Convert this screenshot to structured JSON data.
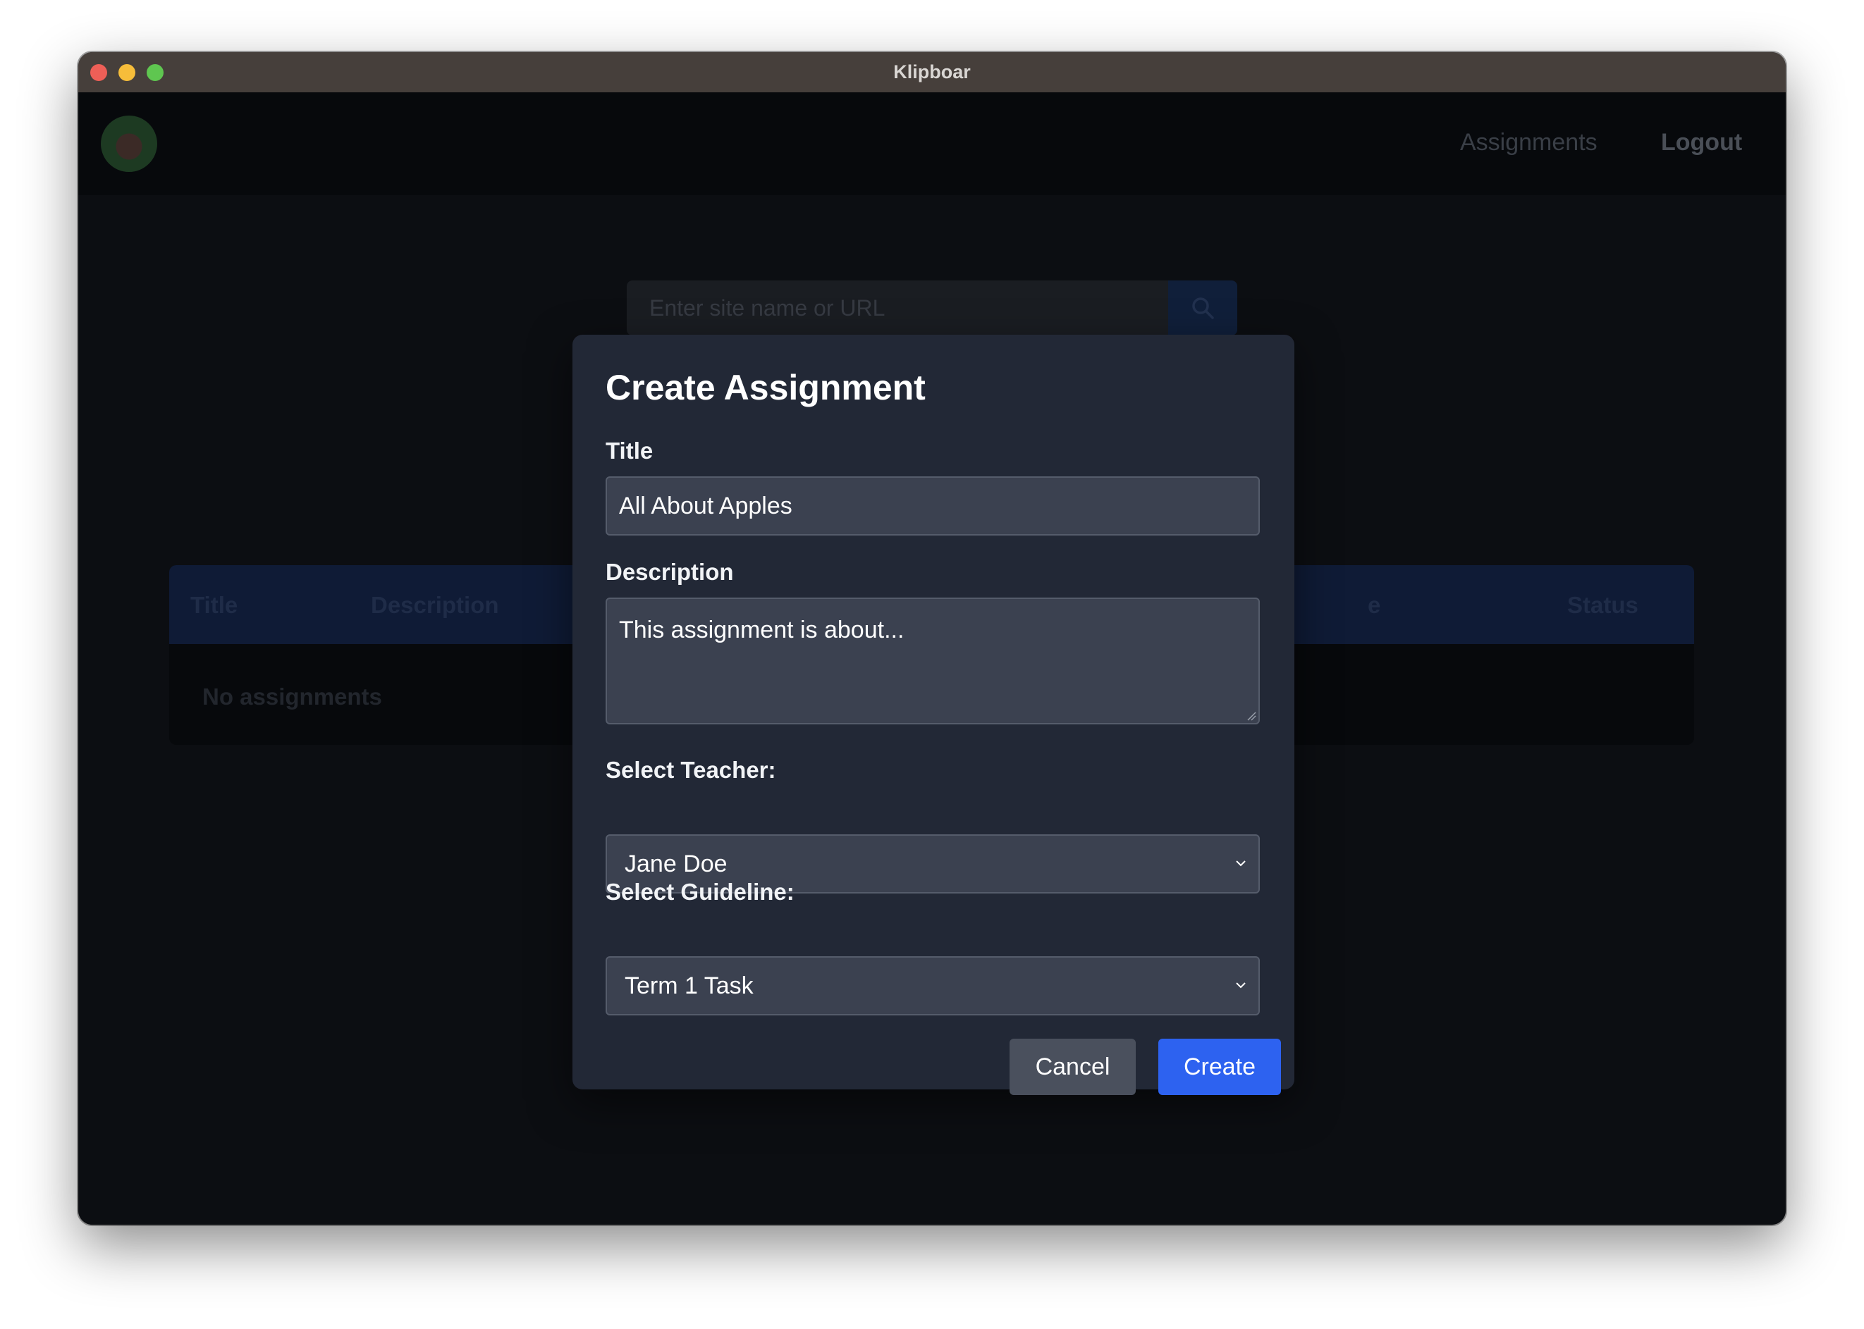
{
  "window": {
    "title": "Klipboar"
  },
  "nav": {
    "links": [
      "Assignments",
      "Logout"
    ]
  },
  "search": {
    "placeholder": "Enter site name or URL"
  },
  "table": {
    "headers": [
      "Title",
      "Description",
      "e",
      "Status"
    ],
    "empty_message": "No assignments"
  },
  "modal": {
    "title": "Create Assignment",
    "title_label": "Title",
    "title_value": "All About Apples",
    "description_label": "Description",
    "description_value": "This assignment is about...",
    "teacher_label": "Select Teacher:",
    "teacher_value": "Jane Doe",
    "guideline_label": "Select Guideline:",
    "guideline_value": "Term 1 Task",
    "cancel_label": "Cancel",
    "create_label": "Create"
  },
  "colors": {
    "primary": "#2d62f0",
    "modal_bg": "#222836",
    "input_bg": "#3b4150"
  },
  "icons": [
    "search-icon",
    "chevron-down-icon"
  ]
}
